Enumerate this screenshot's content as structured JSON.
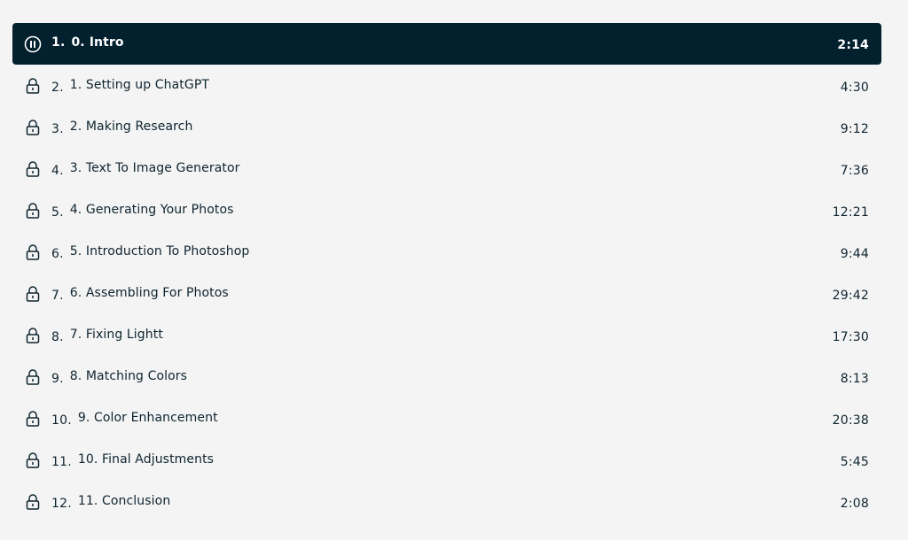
{
  "playlist": {
    "items": [
      {
        "index": "1.",
        "title": "0. Intro",
        "duration": "2:14",
        "icon": "pause-icon",
        "active": true
      },
      {
        "index": "2.",
        "title": "1. Setting up ChatGPT",
        "duration": "4:30",
        "icon": "lock-icon",
        "active": false
      },
      {
        "index": "3.",
        "title": "2. Making Research",
        "duration": "9:12",
        "icon": "lock-icon",
        "active": false
      },
      {
        "index": "4.",
        "title": "3. Text To Image Generator",
        "duration": "7:36",
        "icon": "lock-icon",
        "active": false
      },
      {
        "index": "5.",
        "title": "4. Generating Your Photos",
        "duration": "12:21",
        "icon": "lock-icon",
        "active": false
      },
      {
        "index": "6.",
        "title": "5. Introduction To Photoshop",
        "duration": "9:44",
        "icon": "lock-icon",
        "active": false
      },
      {
        "index": "7.",
        "title": "6. Assembling For Photos",
        "duration": "29:42",
        "icon": "lock-icon",
        "active": false
      },
      {
        "index": "8.",
        "title": "7. Fixing Lightt",
        "duration": "17:30",
        "icon": "lock-icon",
        "active": false
      },
      {
        "index": "9.",
        "title": "8. Matching Colors",
        "duration": "8:13",
        "icon": "lock-icon",
        "active": false
      },
      {
        "index": "10.",
        "title": "9. Color Enhancement",
        "duration": "20:38",
        "icon": "lock-icon",
        "active": false
      },
      {
        "index": "11.",
        "title": "10. Final Adjustments",
        "duration": "5:45",
        "icon": "lock-icon",
        "active": false
      },
      {
        "index": "12.",
        "title": "11. Conclusion",
        "duration": "2:08",
        "icon": "lock-icon",
        "active": false
      }
    ]
  },
  "colors": {
    "background": "#f4f4f4",
    "active_row": "#02202e",
    "text": "#0e2430",
    "active_text": "#ffffff"
  }
}
